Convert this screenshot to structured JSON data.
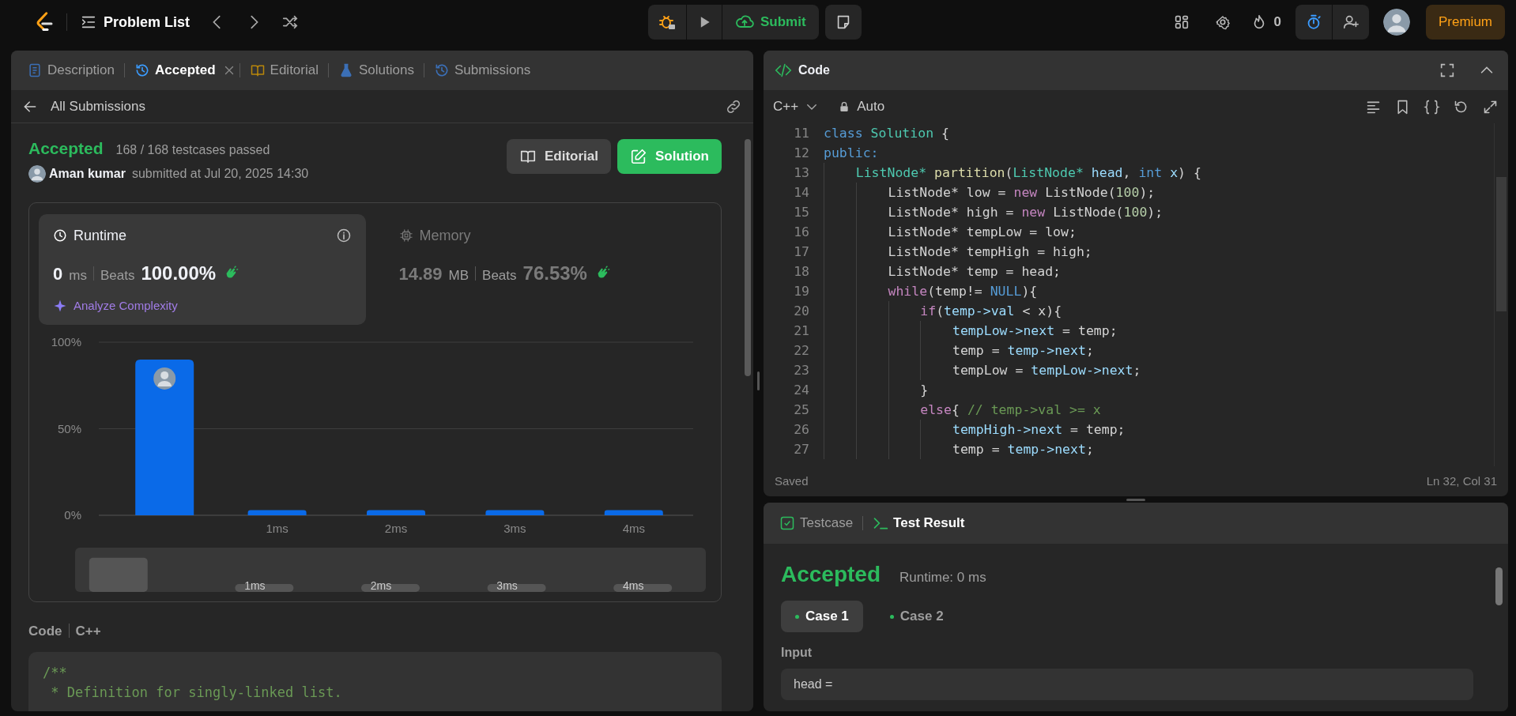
{
  "top_bar": {
    "nav_title": "Problem List",
    "submit": "Submit",
    "streak": "0",
    "premium": "Premium"
  },
  "left_panel": {
    "tabs": [
      {
        "label": "Description",
        "selected": false
      },
      {
        "label": "Accepted",
        "selected": true
      },
      {
        "label": "Editorial",
        "selected": false
      },
      {
        "label": "Solutions",
        "selected": false
      },
      {
        "label": "Submissions",
        "selected": false
      }
    ],
    "back_link": "All Submissions",
    "submission": {
      "status": "Accepted",
      "testcases": "168 / 168 testcases passed",
      "author": "Aman kumar",
      "submitted": "submitted at Jul 20, 2025 14:30",
      "buttons": [
        {
          "label": "Editorial",
          "kind": "secondary"
        },
        {
          "label": "Solution",
          "kind": "primary"
        }
      ]
    },
    "metrics": [
      {
        "label": "Runtime",
        "selected": true,
        "value": "0",
        "unit": "ms",
        "beats_label": "Beats",
        "beats": "100.00%",
        "action": "Analyze Complexity"
      },
      {
        "label": "Memory",
        "selected": false,
        "value": "14.89",
        "unit": "MB",
        "beats_label": "Beats",
        "beats": "76.53%"
      }
    ],
    "chart_data": {
      "type": "bar",
      "categories": [
        null,
        "1ms",
        "2ms",
        "3ms",
        "4ms"
      ],
      "values": [
        90,
        3,
        3,
        3,
        3
      ],
      "ylim": [
        0,
        100
      ],
      "yticks": [
        {
          "value": 0,
          "label": "0%"
        },
        {
          "value": 50,
          "label": "50%"
        },
        {
          "value": 100,
          "label": "100%"
        }
      ]
    },
    "overview_labels": [
      "1ms",
      "2ms",
      "3ms",
      "4ms"
    ],
    "code_heading": {
      "title": "Code",
      "language": "C++"
    },
    "code_preview": [
      "/**",
      " * Definition for singly-linked list."
    ]
  },
  "right_panel": {
    "editor": {
      "title": "Code",
      "language": "C++",
      "mode": "Auto",
      "lines": [
        {
          "n": "11",
          "tokens": [
            {
              "kind": "kw",
              "t": "class "
            },
            {
              "kind": "type",
              "t": "Solution"
            },
            {
              "kind": "txt",
              "t": " {"
            }
          ]
        },
        {
          "n": "12",
          "tokens": [
            {
              "kind": "kw",
              "t": "public:"
            }
          ]
        },
        {
          "n": "13",
          "tokens": [
            {
              "kind": "type",
              "t": "    ListNode* "
            },
            {
              "kind": "fn",
              "t": "partition"
            },
            {
              "kind": "txt",
              "t": "("
            },
            {
              "kind": "type",
              "t": "ListNode* "
            },
            {
              "kind": "var",
              "t": "head"
            },
            {
              "kind": "txt",
              "t": ", "
            },
            {
              "kind": "kw",
              "t": "int "
            },
            {
              "kind": "var",
              "t": "x"
            },
            {
              "kind": "txt",
              "t": ") {"
            }
          ]
        },
        {
          "n": "14",
          "tokens": [
            {
              "kind": "txt",
              "t": "        ListNode* low = "
            },
            {
              "kind": "ctl",
              "t": "new"
            },
            {
              "kind": "txt",
              "t": " ListNode("
            },
            {
              "kind": "num",
              "t": "100"
            },
            {
              "kind": "txt",
              "t": ");"
            }
          ]
        },
        {
          "n": "15",
          "tokens": [
            {
              "kind": "txt",
              "t": "        ListNode* high = "
            },
            {
              "kind": "ctl",
              "t": "new"
            },
            {
              "kind": "txt",
              "t": " ListNode("
            },
            {
              "kind": "num",
              "t": "100"
            },
            {
              "kind": "txt",
              "t": ");"
            }
          ]
        },
        {
          "n": "16",
          "tokens": [
            {
              "kind": "txt",
              "t": "        ListNode* tempLow = low;"
            }
          ]
        },
        {
          "n": "17",
          "tokens": [
            {
              "kind": "txt",
              "t": "        ListNode* tempHigh = high;"
            }
          ]
        },
        {
          "n": "18",
          "tokens": [
            {
              "kind": "txt",
              "t": "        ListNode* temp = head;"
            }
          ]
        },
        {
          "n": "19",
          "tokens": [
            {
              "kind": "ctl",
              "t": "        while"
            },
            {
              "kind": "txt",
              "t": "(temp!= "
            },
            {
              "kind": "kw",
              "t": "NULL"
            },
            {
              "kind": "txt",
              "t": "){"
            }
          ]
        },
        {
          "n": "20",
          "tokens": [
            {
              "kind": "ctl",
              "t": "            if"
            },
            {
              "kind": "txt",
              "t": "("
            },
            {
              "kind": "var",
              "t": "temp->val"
            },
            {
              "kind": "txt",
              "t": " < x){"
            }
          ]
        },
        {
          "n": "21",
          "tokens": [
            {
              "kind": "var",
              "t": "                tempLow->next"
            },
            {
              "kind": "txt",
              "t": " = temp;"
            }
          ]
        },
        {
          "n": "22",
          "tokens": [
            {
              "kind": "txt",
              "t": "                temp = "
            },
            {
              "kind": "var",
              "t": "temp->next"
            },
            {
              "kind": "txt",
              "t": ";"
            }
          ]
        },
        {
          "n": "23",
          "tokens": [
            {
              "kind": "txt",
              "t": "                tempLow = "
            },
            {
              "kind": "var",
              "t": "tempLow->next"
            },
            {
              "kind": "txt",
              "t": ";"
            }
          ]
        },
        {
          "n": "24",
          "tokens": [
            {
              "kind": "txt",
              "t": "            }"
            }
          ]
        },
        {
          "n": "25",
          "tokens": [
            {
              "kind": "ctl",
              "t": "            else"
            },
            {
              "kind": "txt",
              "t": "{ "
            },
            {
              "kind": "com",
              "t": "// temp->val >= x"
            }
          ]
        },
        {
          "n": "26",
          "tokens": [
            {
              "kind": "var",
              "t": "                tempHigh->next"
            },
            {
              "kind": "txt",
              "t": " = temp;"
            }
          ]
        },
        {
          "n": "27",
          "tokens": [
            {
              "kind": "txt",
              "t": "                temp = "
            },
            {
              "kind": "var",
              "t": "temp->next"
            },
            {
              "kind": "txt",
              "t": ";"
            }
          ]
        }
      ],
      "status": "Saved",
      "cursor": "Ln 32, Col 31"
    },
    "result": {
      "tabs": [
        {
          "label": "Testcase",
          "selected": false
        },
        {
          "label": "Test Result",
          "selected": true
        }
      ],
      "status": "Accepted",
      "runtime": "Runtime: 0 ms",
      "cases": [
        {
          "label": "Case 1",
          "selected": true
        },
        {
          "label": "Case 2",
          "selected": false
        }
      ],
      "input_label": "Input",
      "input_value": "head ="
    }
  }
}
